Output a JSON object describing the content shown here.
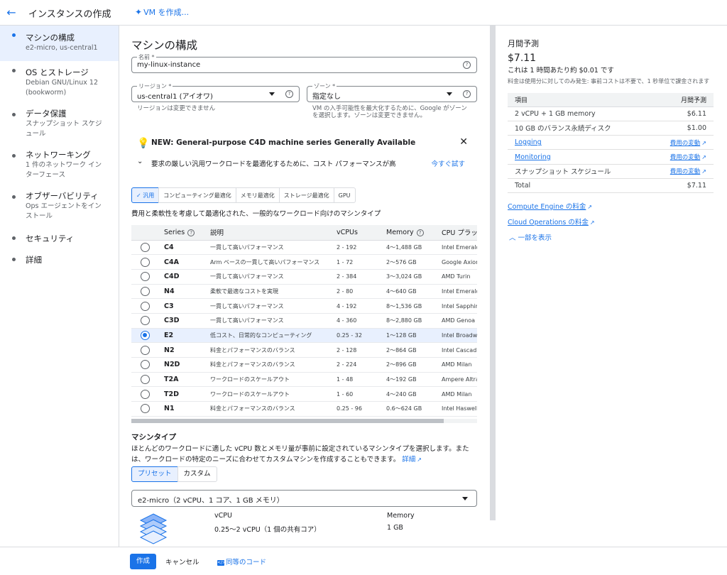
{
  "header": {
    "title": "インスタンスの作成",
    "create_vm": "VM を作成..."
  },
  "nav": [
    {
      "title": "マシンの構成",
      "sub": "e2-micro, us-central1"
    },
    {
      "title": "OS とストレージ",
      "sub": "Debian GNU/Linux 12 (bookworm)"
    },
    {
      "title": "データ保護",
      "sub": "スナップショット スケジュール"
    },
    {
      "title": "ネットワーキング",
      "sub": "1 件のネットワーク インターフェース"
    },
    {
      "title": "オブザーバビリティ",
      "sub": "Ops エージェントをインストール"
    },
    {
      "title": "セキュリティ",
      "sub": ""
    },
    {
      "title": "詳細",
      "sub": ""
    }
  ],
  "main": {
    "heading": "マシンの構成",
    "name_field": {
      "label": "名前 *",
      "value": "my-linux-instance"
    },
    "region_field": {
      "label": "リージョン *",
      "value": "us-central1 (アイオワ)",
      "hint": "リージョンは変更できません"
    },
    "zone_field": {
      "label": "ゾーン *",
      "value": "指定なし",
      "hint1": "VM の入手可能性を最大化するために、Google がゾーン",
      "hint2": "を選択します。ゾーンは変更できません。"
    },
    "banner": {
      "title": "NEW: General-purpose C4D machine series Generally Available",
      "desc": "要求の厳しい汎用ワークロードを最適化するために、コスト パフォーマンスが高",
      "try": "今すぐ試す"
    },
    "chips": [
      "✓ 汎用",
      "コンピューティング最適化",
      "メモリ最適化",
      "ストレージ最適化",
      "GPU"
    ],
    "series_desc": "費用と柔軟性を考慮して最適化された、一般的なワークロード向けのマシンタイプ",
    "table": {
      "headers": [
        "Series",
        "説明",
        "vCPUs",
        "Memory",
        "CPU プラッ"
      ],
      "rows": [
        {
          "series": "C4",
          "desc": "一貫して高いパフォーマンス",
          "vcpus": "2 - 192",
          "memory": "4～1,488 GB",
          "cpu": "Intel Emerald"
        },
        {
          "series": "C4A",
          "desc": "Arm ベースの一貫して高いパフォーマンス",
          "vcpus": "1 - 72",
          "memory": "2～576 GB",
          "cpu": "Google Axion"
        },
        {
          "series": "C4D",
          "desc": "一貫して高いパフォーマンス",
          "vcpus": "2 - 384",
          "memory": "3～3,024 GB",
          "cpu": "AMD Turin"
        },
        {
          "series": "N4",
          "desc": "柔軟で最適なコストを実現",
          "vcpus": "2 - 80",
          "memory": "4～640 GB",
          "cpu": "Intel Emerald"
        },
        {
          "series": "C3",
          "desc": "一貫して高いパフォーマンス",
          "vcpus": "4 - 192",
          "memory": "8～1,536 GB",
          "cpu": "Intel Sapphir"
        },
        {
          "series": "C3D",
          "desc": "一貫して高いパフォーマンス",
          "vcpus": "4 - 360",
          "memory": "8～2,880 GB",
          "cpu": "AMD Genoa"
        },
        {
          "series": "E2",
          "desc": "低コスト、日常的なコンピューティング",
          "vcpus": "0.25 - 32",
          "memory": "1～128 GB",
          "cpu": "Intel Broadw"
        },
        {
          "series": "N2",
          "desc": "料金とパフォーマンスのバランス",
          "vcpus": "2 - 128",
          "memory": "2～864 GB",
          "cpu": "Intel Cascad"
        },
        {
          "series": "N2D",
          "desc": "料金とパフォーマンスのバランス",
          "vcpus": "2 - 224",
          "memory": "2～896 GB",
          "cpu": "AMD Milan"
        },
        {
          "series": "T2A",
          "desc": "ワークロードのスケールアウト",
          "vcpus": "1 - 48",
          "memory": "4～192 GB",
          "cpu": "Ampere Altra"
        },
        {
          "series": "T2D",
          "desc": "ワークロードのスケールアウト",
          "vcpus": "1 - 60",
          "memory": "4～240 GB",
          "cpu": "AMD Milan"
        },
        {
          "series": "N1",
          "desc": "料金とパフォーマンスのバランス",
          "vcpus": "0.25 - 96",
          "memory": "0.6～624 GB",
          "cpu": "Intel Haswell"
        }
      ],
      "selected": "E2"
    },
    "machine_type": {
      "title": "マシンタイプ",
      "desc": "ほとんどのワークロードに適した vCPU 数とメモリ量が事前に設定されているマシンタイプを選択します。または、ワークロードの特定のニーズに合わせてカスタムマシンを作成することもできます。",
      "link": "詳細",
      "preset": "プリセット",
      "custom": "カスタム",
      "selected": "e2-micro（2 vCPU、1 コア、1 GB メモリ）",
      "vcpu_label": "vCPU",
      "vcpu_value": "0.25～2 vCPU（1 個の共有コア）",
      "memory_label": "Memory",
      "memory_value": "1 GB"
    }
  },
  "estimate": {
    "title": "月間予測",
    "price": "$7.11",
    "per_hour": "これは 1 時間あたり約 $0.01 です",
    "note": "料金は使用分に対してのみ発生: 事前コストは不要で、1 秒単位で課金されます",
    "col_item": "項目",
    "col_monthly": "月間予測",
    "rows": [
      {
        "item": "2 vCPU + 1 GB memory",
        "value": "$6.11"
      },
      {
        "item": "10 GB のバランス永続ディスク",
        "value": "$1.00"
      },
      {
        "item": "Logging",
        "value": "費用の変動"
      },
      {
        "item": "Monitoring",
        "value": "費用の変動"
      },
      {
        "item": "スナップショット スケジュール",
        "value": "費用の変動"
      },
      {
        "item": "Total",
        "value": "$7.11"
      }
    ],
    "link_compute": "Compute Engine の料金",
    "link_ops": "Cloud Operations の料金",
    "show_less": "一部を表示"
  },
  "footer": {
    "create": "作成",
    "cancel": "キャンセル",
    "code": "同等のコード"
  }
}
